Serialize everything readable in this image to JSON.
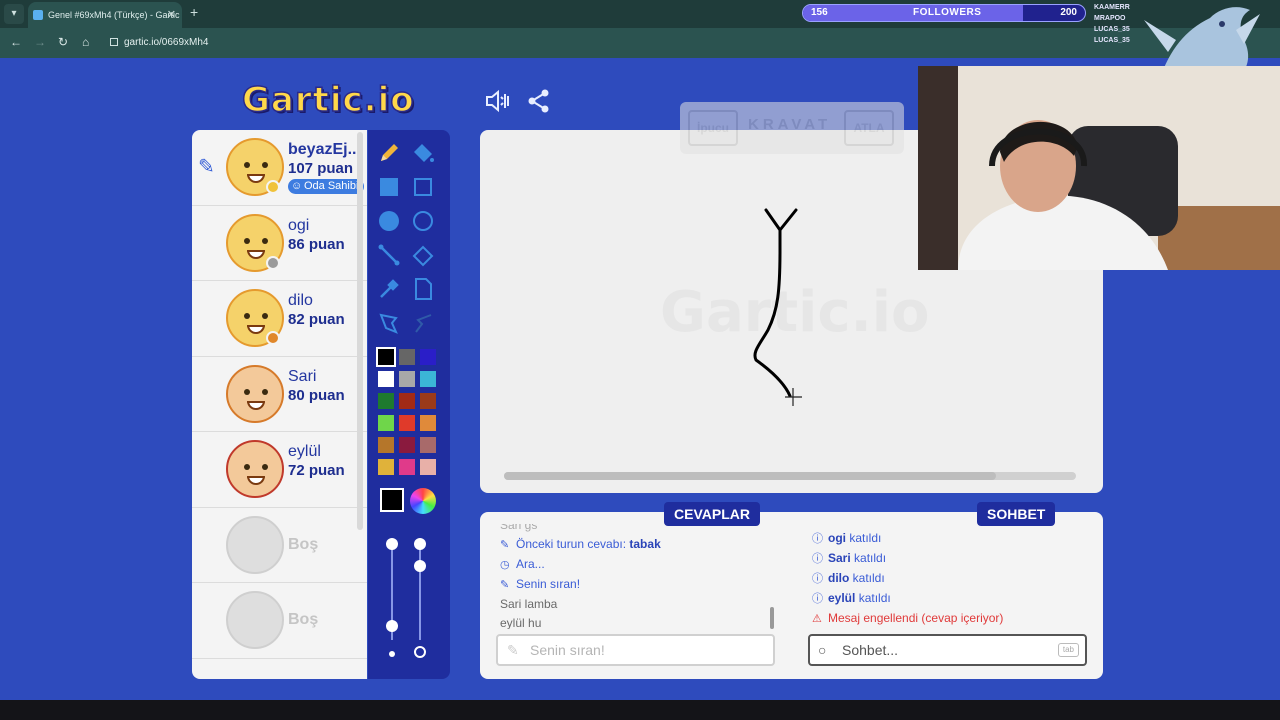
{
  "browser": {
    "tab_title": "Genel #69xMh4 (Türkçe) - Gartic",
    "url": "gartic.io/0669xMh4"
  },
  "stream": {
    "followers_current": "156",
    "followers_label": "FOLLOWERS",
    "followers_goal": "200",
    "followers_progress": 0.78,
    "recent": [
      "KAAMERR",
      "MRAPOO",
      "LUCAS_35",
      "LUCAS_35"
    ]
  },
  "header": {
    "logo": "Gartic.io"
  },
  "players": [
    {
      "name": "beyazEj...",
      "score": "107 puan",
      "badge": "Oda Sahibi",
      "status_color": "#f0c23a",
      "drawing": true,
      "avatar": "girl-smile-icon"
    },
    {
      "name": "ogi",
      "score": "86 puan",
      "status_color": "#9a9a9a",
      "avatar": "smile-avatar-icon"
    },
    {
      "name": "dilo",
      "score": "82 puan",
      "status_color": "#e0872a",
      "avatar": "smile-avatar-icon"
    },
    {
      "name": "Sari",
      "score": "80 puan",
      "avatar": "blonde-avatar-icon"
    },
    {
      "name": "eylül",
      "score": "72 puan",
      "avatar": "glasses-avatar-icon"
    },
    {
      "name": "Boş"
    },
    {
      "name": "Boş"
    }
  ],
  "palette": {
    "colors": [
      "#000000",
      "#666666",
      "#2a1ec8",
      "#ffffff",
      "#a8a8a8",
      "#3bb6d6",
      "#1e7a2e",
      "#a22a16",
      "#9a3a1a",
      "#6fd64a",
      "#e03a2a",
      "#e08a3a",
      "#b5762a",
      "#8a1a3e",
      "#a86a6a",
      "#e0b23a",
      "#e03a8a",
      "#e8b0a8"
    ],
    "selected_color": "#000000"
  },
  "hint": {
    "hint_label": "İpucu",
    "word": "KRAVAT",
    "skip_label": "ATLA"
  },
  "answers": {
    "title": "CEVAPLAR",
    "messages": [
      {
        "type": "plain",
        "text": "Sari gs"
      },
      {
        "type": "pencil",
        "text": "Önceki turun cevabı: ",
        "bold": "tabak"
      },
      {
        "type": "clock",
        "text": "Ara..."
      },
      {
        "type": "pencil",
        "text": "Senin sıran!"
      },
      {
        "type": "plain",
        "text": "Sari lamba"
      },
      {
        "type": "plain",
        "text": "eylül hu"
      }
    ],
    "input_placeholder": "Senin sıran!"
  },
  "chat": {
    "title": "SOHBET",
    "messages": [
      {
        "type": "info",
        "bold": "ogi",
        "text": " katıldı"
      },
      {
        "type": "info",
        "bold": "Sari",
        "text": " katıldı"
      },
      {
        "type": "info",
        "bold": "dilo",
        "text": " katıldı"
      },
      {
        "type": "info",
        "bold": "eylül",
        "text": " katıldı"
      },
      {
        "type": "warn",
        "text": "Mesaj engellendi (cevap içeriyor)"
      }
    ],
    "input_placeholder": "Sohbet...",
    "tab_hint": "tab"
  }
}
